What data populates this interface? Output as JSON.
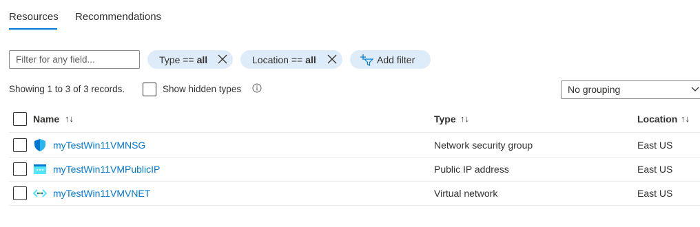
{
  "tabs": [
    {
      "label": "Resources",
      "active": true
    },
    {
      "label": "Recommendations",
      "active": false
    }
  ],
  "filters": {
    "placeholder": "Filter for any field...",
    "pills": [
      {
        "key": "Type ==",
        "value": "all"
      },
      {
        "key": "Location ==",
        "value": "all"
      }
    ],
    "add_filter_label": "Add filter"
  },
  "records_text": "Showing 1 to 3 of 3 records.",
  "show_hidden_label": "Show hidden types",
  "grouping": {
    "selected": "No grouping"
  },
  "table": {
    "columns": [
      "Name",
      "Type",
      "Location"
    ],
    "sort_name": "↑↓",
    "sort_type": "↑↓",
    "sort_location": "↑↓",
    "rows": [
      {
        "name": "myTestWin11VMNSG",
        "type": "Network security group",
        "location": "East US",
        "icon": "shield-icon"
      },
      {
        "name": "myTestWin11VMPublicIP",
        "type": "Public IP address",
        "location": "East US",
        "icon": "public-ip-icon"
      },
      {
        "name": "myTestWin11VMVNET",
        "type": "Virtual network",
        "location": "East US",
        "icon": "vnet-icon"
      }
    ]
  },
  "colors": {
    "accent": "#0078d4",
    "pill_bg": "#deecf9",
    "border": "#8a8886"
  }
}
